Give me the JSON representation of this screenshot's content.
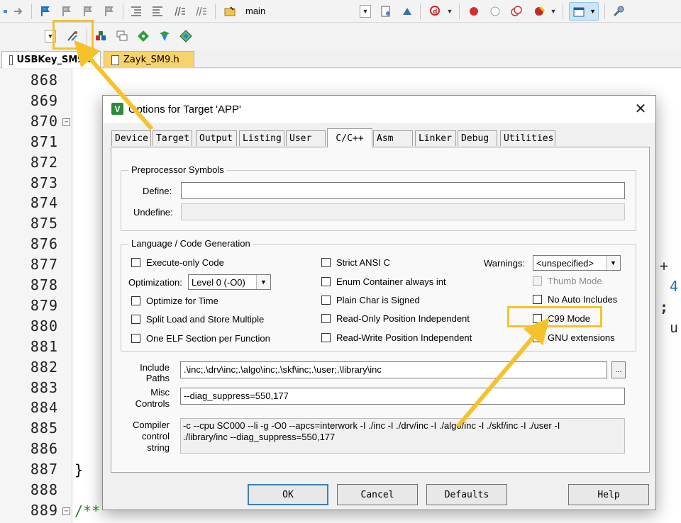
{
  "toolbar1": {
    "project_target": "main"
  },
  "file_tabs": [
    {
      "label": "USBKey_SM9.c",
      "active": true
    },
    {
      "label": "Zayk_SM9.h",
      "active": false
    }
  ],
  "editor": {
    "line_numbers": [
      "868",
      "869",
      "870",
      "871",
      "872",
      "873",
      "874",
      "875",
      "876",
      "877",
      "878",
      "879",
      "880",
      "881",
      "882",
      "883",
      "884",
      "885",
      "886",
      "887",
      "888",
      "889"
    ],
    "closing_brace": "}",
    "comment_start": "/**",
    "visible_right_fragments": [
      "+",
      "4",
      ";",
      "u"
    ]
  },
  "dialog": {
    "title": "Options for Target 'APP'",
    "close_glyph": "✕",
    "tabs": [
      "Device",
      "Target",
      "Output",
      "Listing",
      "User",
      "C/C++",
      "Asm",
      "Linker",
      "Debug",
      "Utilities"
    ],
    "active_tab": "C/C++",
    "preprocessor": {
      "group_label": "Preprocessor Symbols",
      "define_label": "Define:",
      "define_value": "",
      "undefine_label": "Undefine:",
      "undefine_value": ""
    },
    "language": {
      "group_label": "Language / Code Generation",
      "execute_only": "Execute-only Code",
      "optimization_label": "Optimization:",
      "optimization_value": "Level 0 (-O0)",
      "optimize_time": "Optimize for Time",
      "split_load": "Split Load and Store Multiple",
      "one_elf": "One ELF Section per Function",
      "strict_ansi": "Strict ANSI C",
      "enum_container": "Enum Container always int",
      "plain_char": "Plain Char is Signed",
      "ro_pi": "Read-Only Position Independent",
      "rw_pi": "Read-Write Position Independent",
      "warnings_label": "Warnings:",
      "warnings_value": "<unspecified>",
      "thumb_mode": "Thumb Mode",
      "no_auto_includes": "No Auto Includes",
      "c99_mode": "C99 Mode",
      "gnu_extensions": "GNU extensions"
    },
    "include_paths_label_1": "Include",
    "include_paths_label_2": "Paths",
    "include_paths_value": ".\\inc;.\\drv\\inc;.\\algo\\inc;.\\skf\\inc;.\\user;.\\library\\inc",
    "browse_label": "...",
    "misc_label_1": "Misc",
    "misc_label_2": "Controls",
    "misc_value": "--diag_suppress=550,177",
    "compiler_label_1": "Compiler",
    "compiler_label_2": "control",
    "compiler_label_3": "string",
    "compiler_line_1": "-c --cpu SC000 --li -g -O0 --apcs=interwork -I ./inc -I ./drv/inc -I ./algo/inc -I ./skf/inc -I ./user -I",
    "compiler_line_2": "./library/inc --diag_suppress=550,177",
    "buttons": {
      "ok": "OK",
      "cancel": "Cancel",
      "defaults": "Defaults",
      "help": "Help"
    }
  },
  "colors": {
    "highlight": "#f6c22b",
    "arrow": "#f6c22b"
  }
}
